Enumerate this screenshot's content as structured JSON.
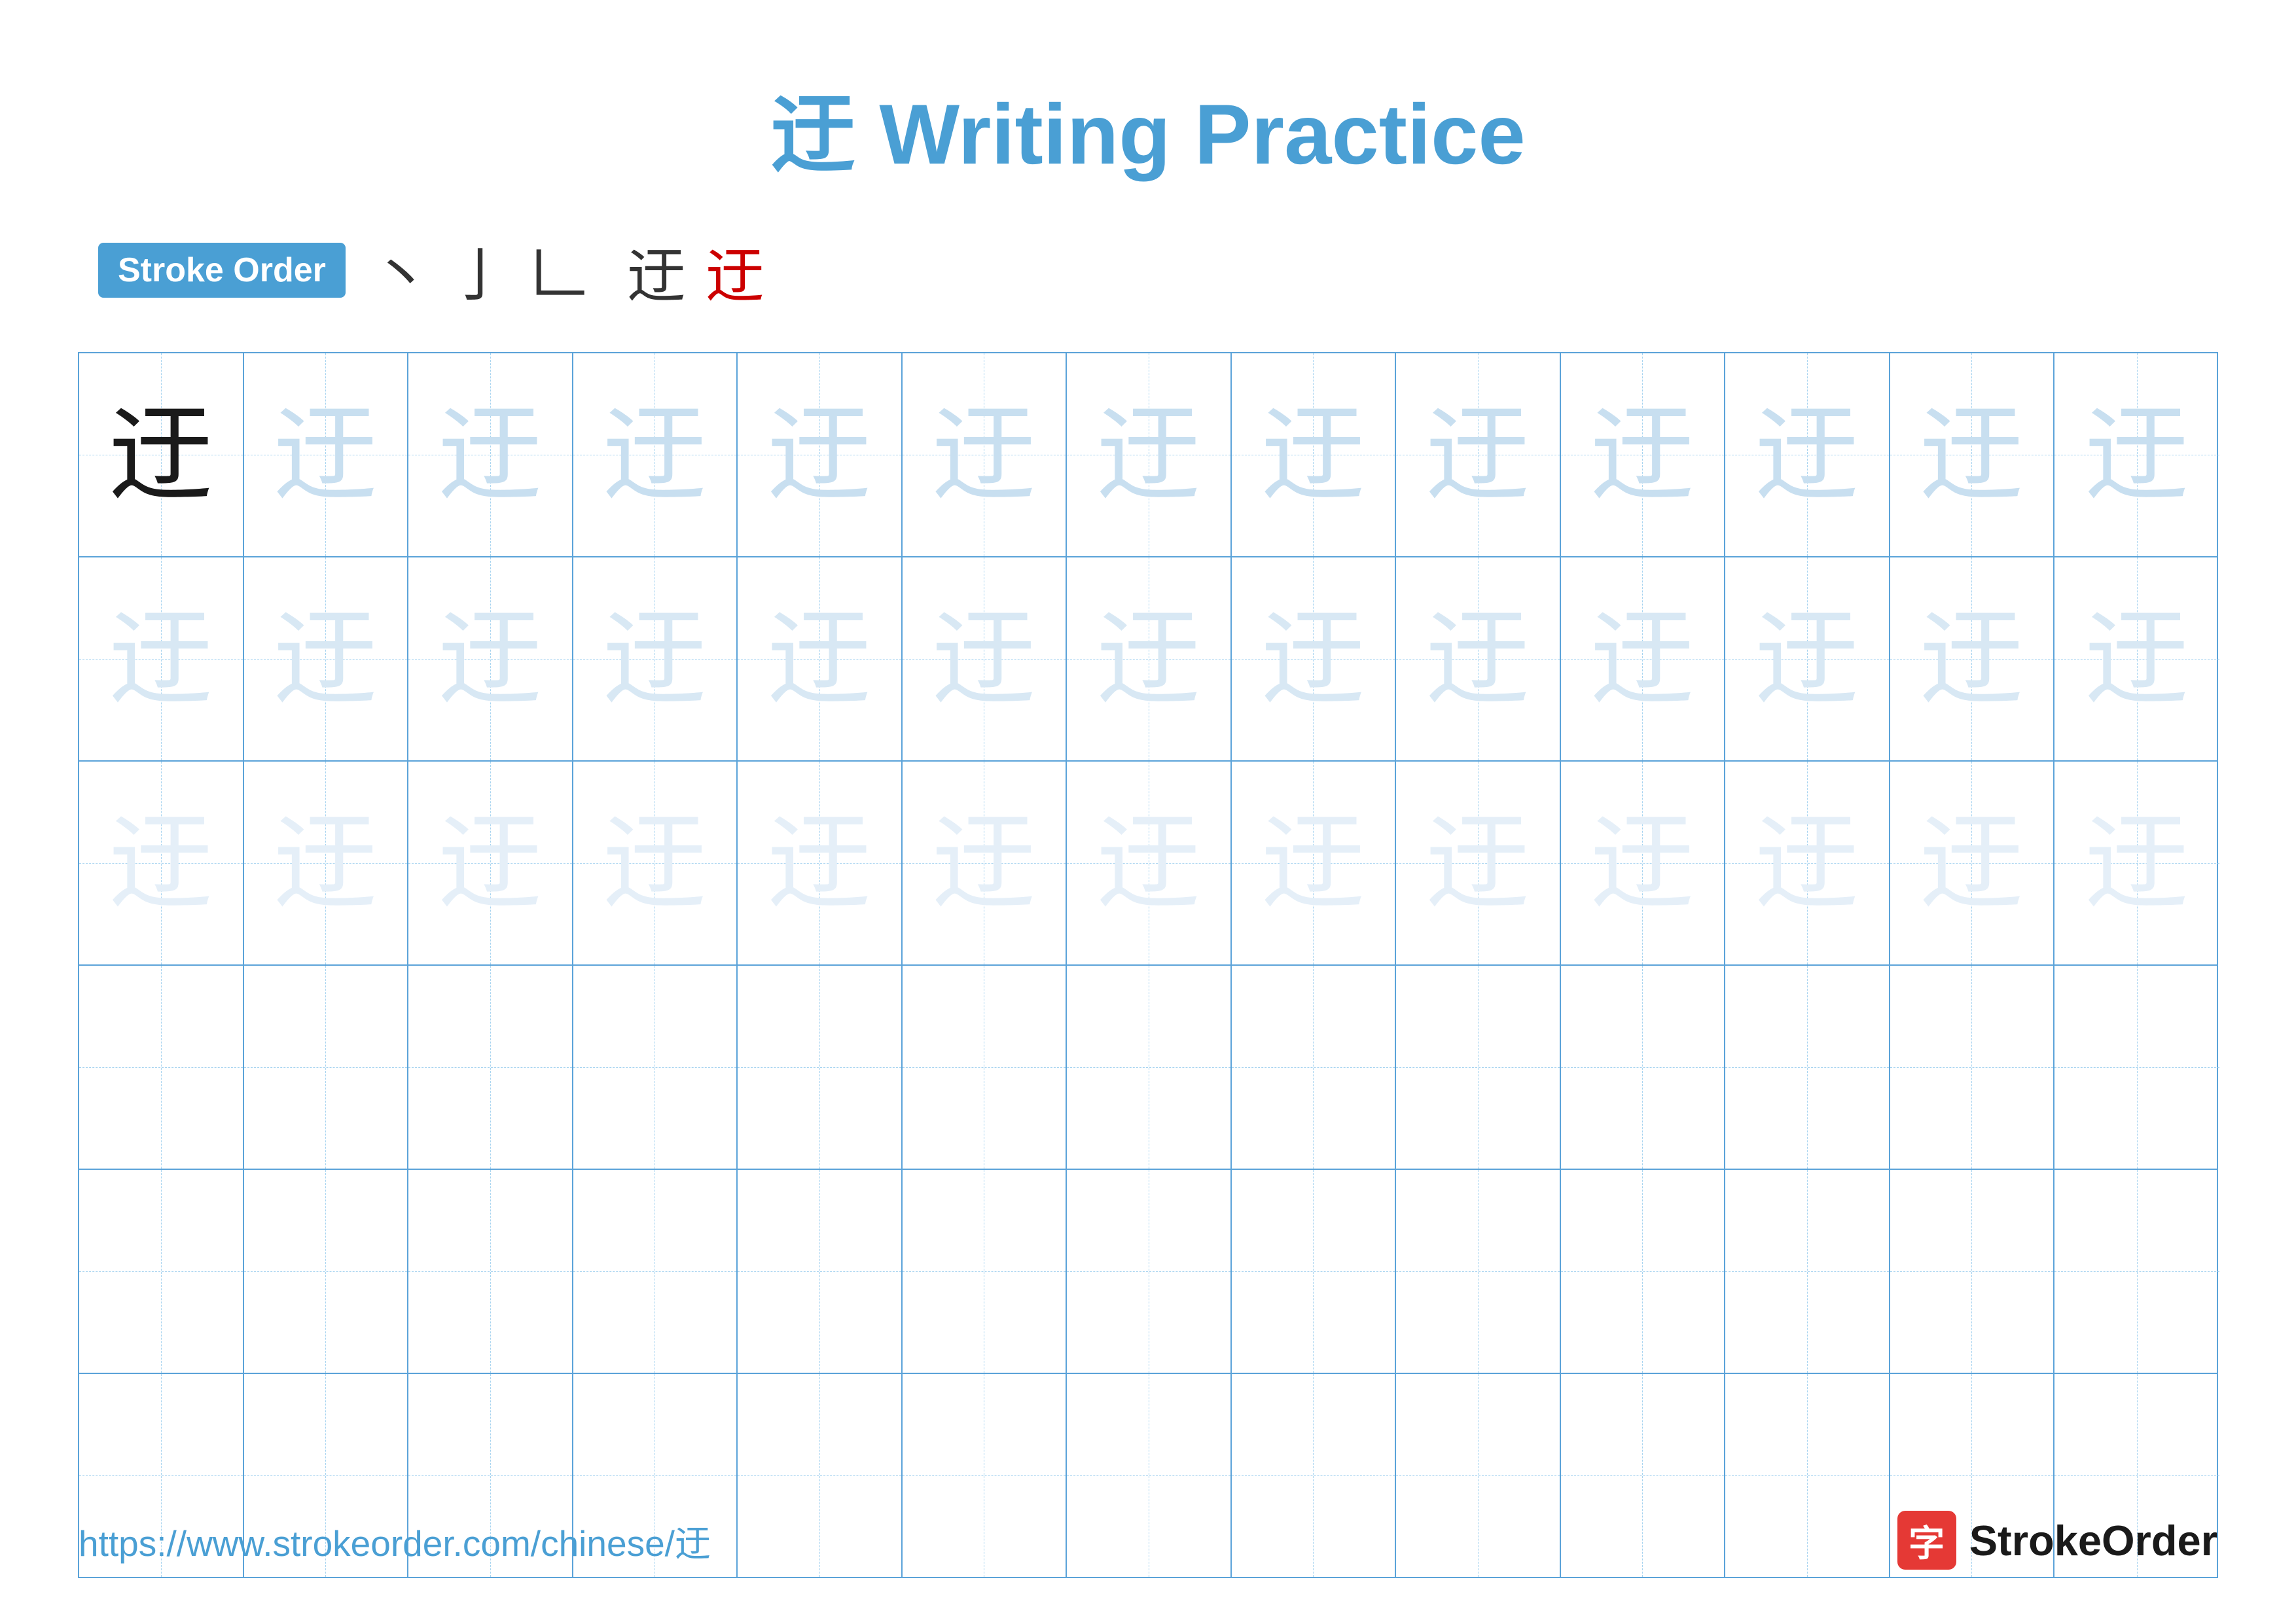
{
  "title": "迂 Writing Practice",
  "stroke_order": {
    "badge_label": "Stroke Order",
    "strokes": [
      "丶",
      "亅",
      "𠃊",
      "𰥓",
      "迂",
      "迂"
    ]
  },
  "character": "迂",
  "grid": {
    "rows": 6,
    "cols": 13
  },
  "footer": {
    "url": "https://www.strokeorder.com/chinese/迂",
    "logo_char": "字",
    "logo_text": "StrokeOrder"
  }
}
